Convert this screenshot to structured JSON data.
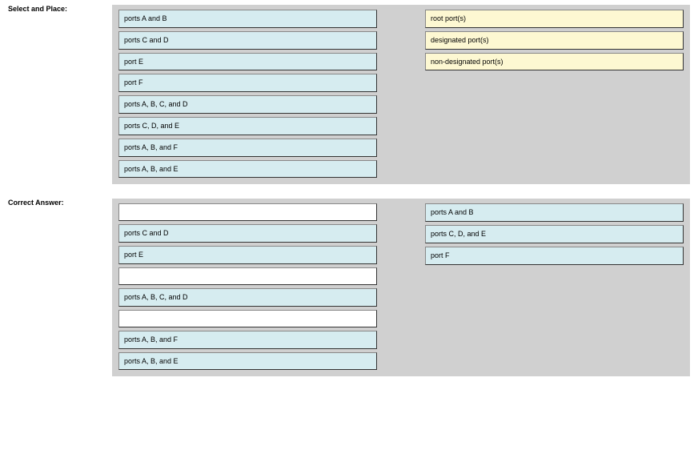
{
  "select_place": {
    "label": "Select and Place:",
    "left": [
      "ports A and B",
      "ports C and D",
      "port E",
      "port F",
      "ports A, B, C, and D",
      "ports C, D, and E",
      "ports A, B, and F",
      "ports A, B, and E"
    ],
    "right": [
      "root port(s)",
      "designated port(s)",
      "non-designated port(s)"
    ]
  },
  "correct_answer": {
    "label": "Correct Answer:",
    "left": [
      {
        "text": "",
        "empty": true
      },
      {
        "text": "ports C and D",
        "empty": false
      },
      {
        "text": "port E",
        "empty": false
      },
      {
        "text": "",
        "empty": true
      },
      {
        "text": "ports A, B, C, and D",
        "empty": false
      },
      {
        "text": "",
        "empty": true
      },
      {
        "text": "ports A, B, and F",
        "empty": false
      },
      {
        "text": "ports A, B, and E",
        "empty": false
      }
    ],
    "right": [
      "ports A and B",
      "ports C, D, and E",
      "port F"
    ]
  }
}
